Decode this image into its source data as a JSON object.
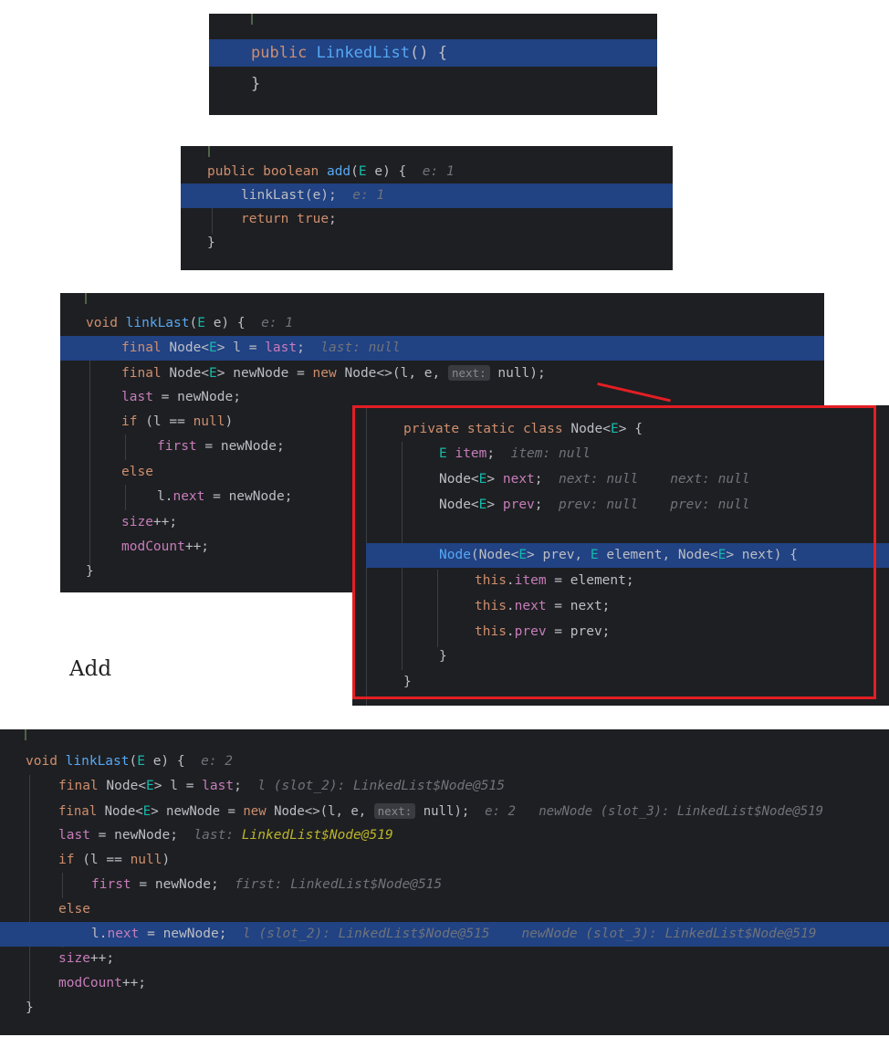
{
  "panel1": {
    "line1": {
      "kw": "public",
      "fn": "LinkedList",
      "rest": "() {"
    },
    "line2": "}"
  },
  "panel2": {
    "line1": {
      "kw1": "public",
      "kw2": "boolean",
      "fn": "add",
      "p1": "(",
      "ty": "E",
      "p2": " e) {",
      "hint": "e: 1"
    },
    "line2": {
      "code": "linkLast(e);",
      "hint": "e: 1"
    },
    "line3": {
      "kw": "return",
      "val": "true",
      "end": ";"
    },
    "line4": "}"
  },
  "panel3": {
    "l1": {
      "kw": "void",
      "fn": "linkLast",
      "p1": "(",
      "ty": "E",
      "p2": " e) {",
      "hint": "e: 1"
    },
    "l2": {
      "kw": "final",
      "a": "Node<",
      "ty": "E",
      "b": "> l = ",
      "fld": "last",
      "c": ";",
      "hint": "last: null"
    },
    "l3": {
      "kw": "final",
      "a": "Node<",
      "ty": "E",
      "b": "> newNode = ",
      "kw2": "new",
      "c": "Node<>(l, e, ",
      "badge": "next:",
      "d": "null);"
    },
    "l4": {
      "fld": "last",
      "rest": " = newNode;"
    },
    "l5": {
      "kw": "if",
      "a": " (l == ",
      "kw2": "null",
      "b": ")"
    },
    "l6": {
      "fld": "first",
      "rest": " = newNode;"
    },
    "l7": {
      "kw": "else"
    },
    "l8": {
      "a": "l.",
      "fld": "next",
      "b": " = newNode;"
    },
    "l9": {
      "fld": "size",
      "rest": "++;"
    },
    "l10": {
      "fld": "modCount",
      "rest": "++;"
    },
    "l11": "}"
  },
  "panel4": {
    "l1": {
      "kw": "private static class",
      "a": " Node<",
      "ty": "E",
      "b": "> {"
    },
    "l2": {
      "ty": "E",
      "fld": "item",
      "c": ";",
      "hint": "item: null"
    },
    "l3": {
      "a": "Node<",
      "ty": "E",
      "b": "> ",
      "fld": "next",
      "c": ";",
      "hint1": "next: null",
      "hint2": "next: null"
    },
    "l4": {
      "a": "Node<",
      "ty": "E",
      "b": "> ",
      "fld": "prev",
      "c": ";",
      "hint1": "prev: null",
      "hint2": "prev: null"
    },
    "l5": {
      "fn": "Node",
      "a": "(Node<",
      "ty1": "E",
      "b": "> prev, ",
      "ty2": "E",
      "c": " element, Node<",
      "ty3": "E",
      "d": "> next) {"
    },
    "l6": {
      "kw": "this",
      "dot": ".",
      "fld": "item",
      "rest": " = element;"
    },
    "l7": {
      "kw": "this",
      "dot": ".",
      "fld": "next",
      "rest": " = next;"
    },
    "l8": {
      "kw": "this",
      "dot": ".",
      "fld": "prev",
      "rest": " = prev;"
    },
    "l9": "}",
    "l10": "}"
  },
  "caption": "Add",
  "panel5": {
    "l1": {
      "kw": "void",
      "fn": "linkLast",
      "p1": "(",
      "ty": "E",
      "p2": " e) {",
      "hint": "e: 2"
    },
    "l2": {
      "kw": "final",
      "a": "Node<",
      "ty": "E",
      "b": "> l = ",
      "fld": "last",
      "c": ";",
      "hint": "l (slot_2): LinkedList$Node@515"
    },
    "l3": {
      "kw": "final",
      "a": "Node<",
      "ty": "E",
      "b": "> newNode = ",
      "kw2": "new",
      "c": "Node<>(l, e, ",
      "badge": "next:",
      "d": "null);",
      "hint1": "e: 2",
      "hint2": "newNode (slot_3): LinkedList$Node@519"
    },
    "l4": {
      "fld": "last",
      "rest": " = newNode;",
      "hintLabel": "last:",
      "hintVal": "LinkedList$Node@519"
    },
    "l5": {
      "kw": "if",
      "a": " (l == ",
      "kw2": "null",
      "b": ")"
    },
    "l6": {
      "fld": "first",
      "rest": " = newNode;",
      "hint": "first: LinkedList$Node@515"
    },
    "l7": {
      "kw": "else"
    },
    "l8": {
      "a": "l.",
      "fld": "next",
      "b": " = newNode;",
      "hint1": "l (slot_2): LinkedList$Node@515",
      "hint2": "newNode (slot_3): LinkedList$Node@519"
    },
    "l9": {
      "fld": "size",
      "rest": "++;"
    },
    "l10": {
      "fld": "modCount",
      "rest": "++;"
    },
    "l11": "}"
  },
  "colors": {
    "background": "#1e1f22",
    "highlight": "#214283",
    "keyword": "#cf8e6d",
    "function": "#56a8f5",
    "type": "#16baac",
    "field": "#c77dbb",
    "hint": "#6f737a",
    "annotation_box": "#e31e24"
  }
}
